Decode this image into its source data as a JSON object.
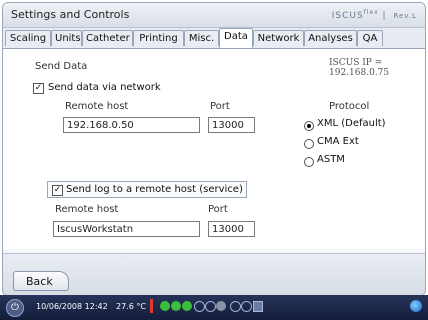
{
  "window": {
    "title": "Settings and Controls",
    "brand": "ISCUS",
    "brand_sup": "flex",
    "rev": "Rev.L"
  },
  "tabs": [
    {
      "label": "Scaling"
    },
    {
      "label": "Units"
    },
    {
      "label": "Catheter"
    },
    {
      "label": "Printing"
    },
    {
      "label": "Misc."
    },
    {
      "label": "Data",
      "active": true
    },
    {
      "label": "Network"
    },
    {
      "label": "Analyses"
    },
    {
      "label": "QA"
    }
  ],
  "content": {
    "section_title": "Send Data",
    "ip_info": "ISCUS IP = 192.168.0.75",
    "send_network": {
      "checked": true,
      "label": "Send data via network",
      "remote_host_label": "Remote host",
      "remote_host_value": "192.168.0.50",
      "port_label": "Port",
      "port_value": "13000"
    },
    "protocol": {
      "label": "Protocol",
      "options": [
        {
          "label": "XML (Default)",
          "selected": true
        },
        {
          "label": "CMA Ext",
          "selected": false
        },
        {
          "label": "ASTM",
          "selected": false
        }
      ]
    },
    "send_log": {
      "checked": true,
      "label": "Send log to a remote host (service)",
      "remote_host_label": "Remote host",
      "remote_host_value": "IscusWorkstatn",
      "port_label": "Port",
      "port_value": "13000"
    }
  },
  "footer": {
    "back_label": "Back"
  },
  "statusbar": {
    "datetime": "10/06/2008 12:42",
    "temperature": "27.6 °C"
  },
  "colors": {
    "status_bg": "#1a2448",
    "accent_green": "#3bbf3b",
    "border": "#9aa7b8"
  },
  "icons": {
    "power": "power-icon",
    "network": "globe-icon"
  }
}
